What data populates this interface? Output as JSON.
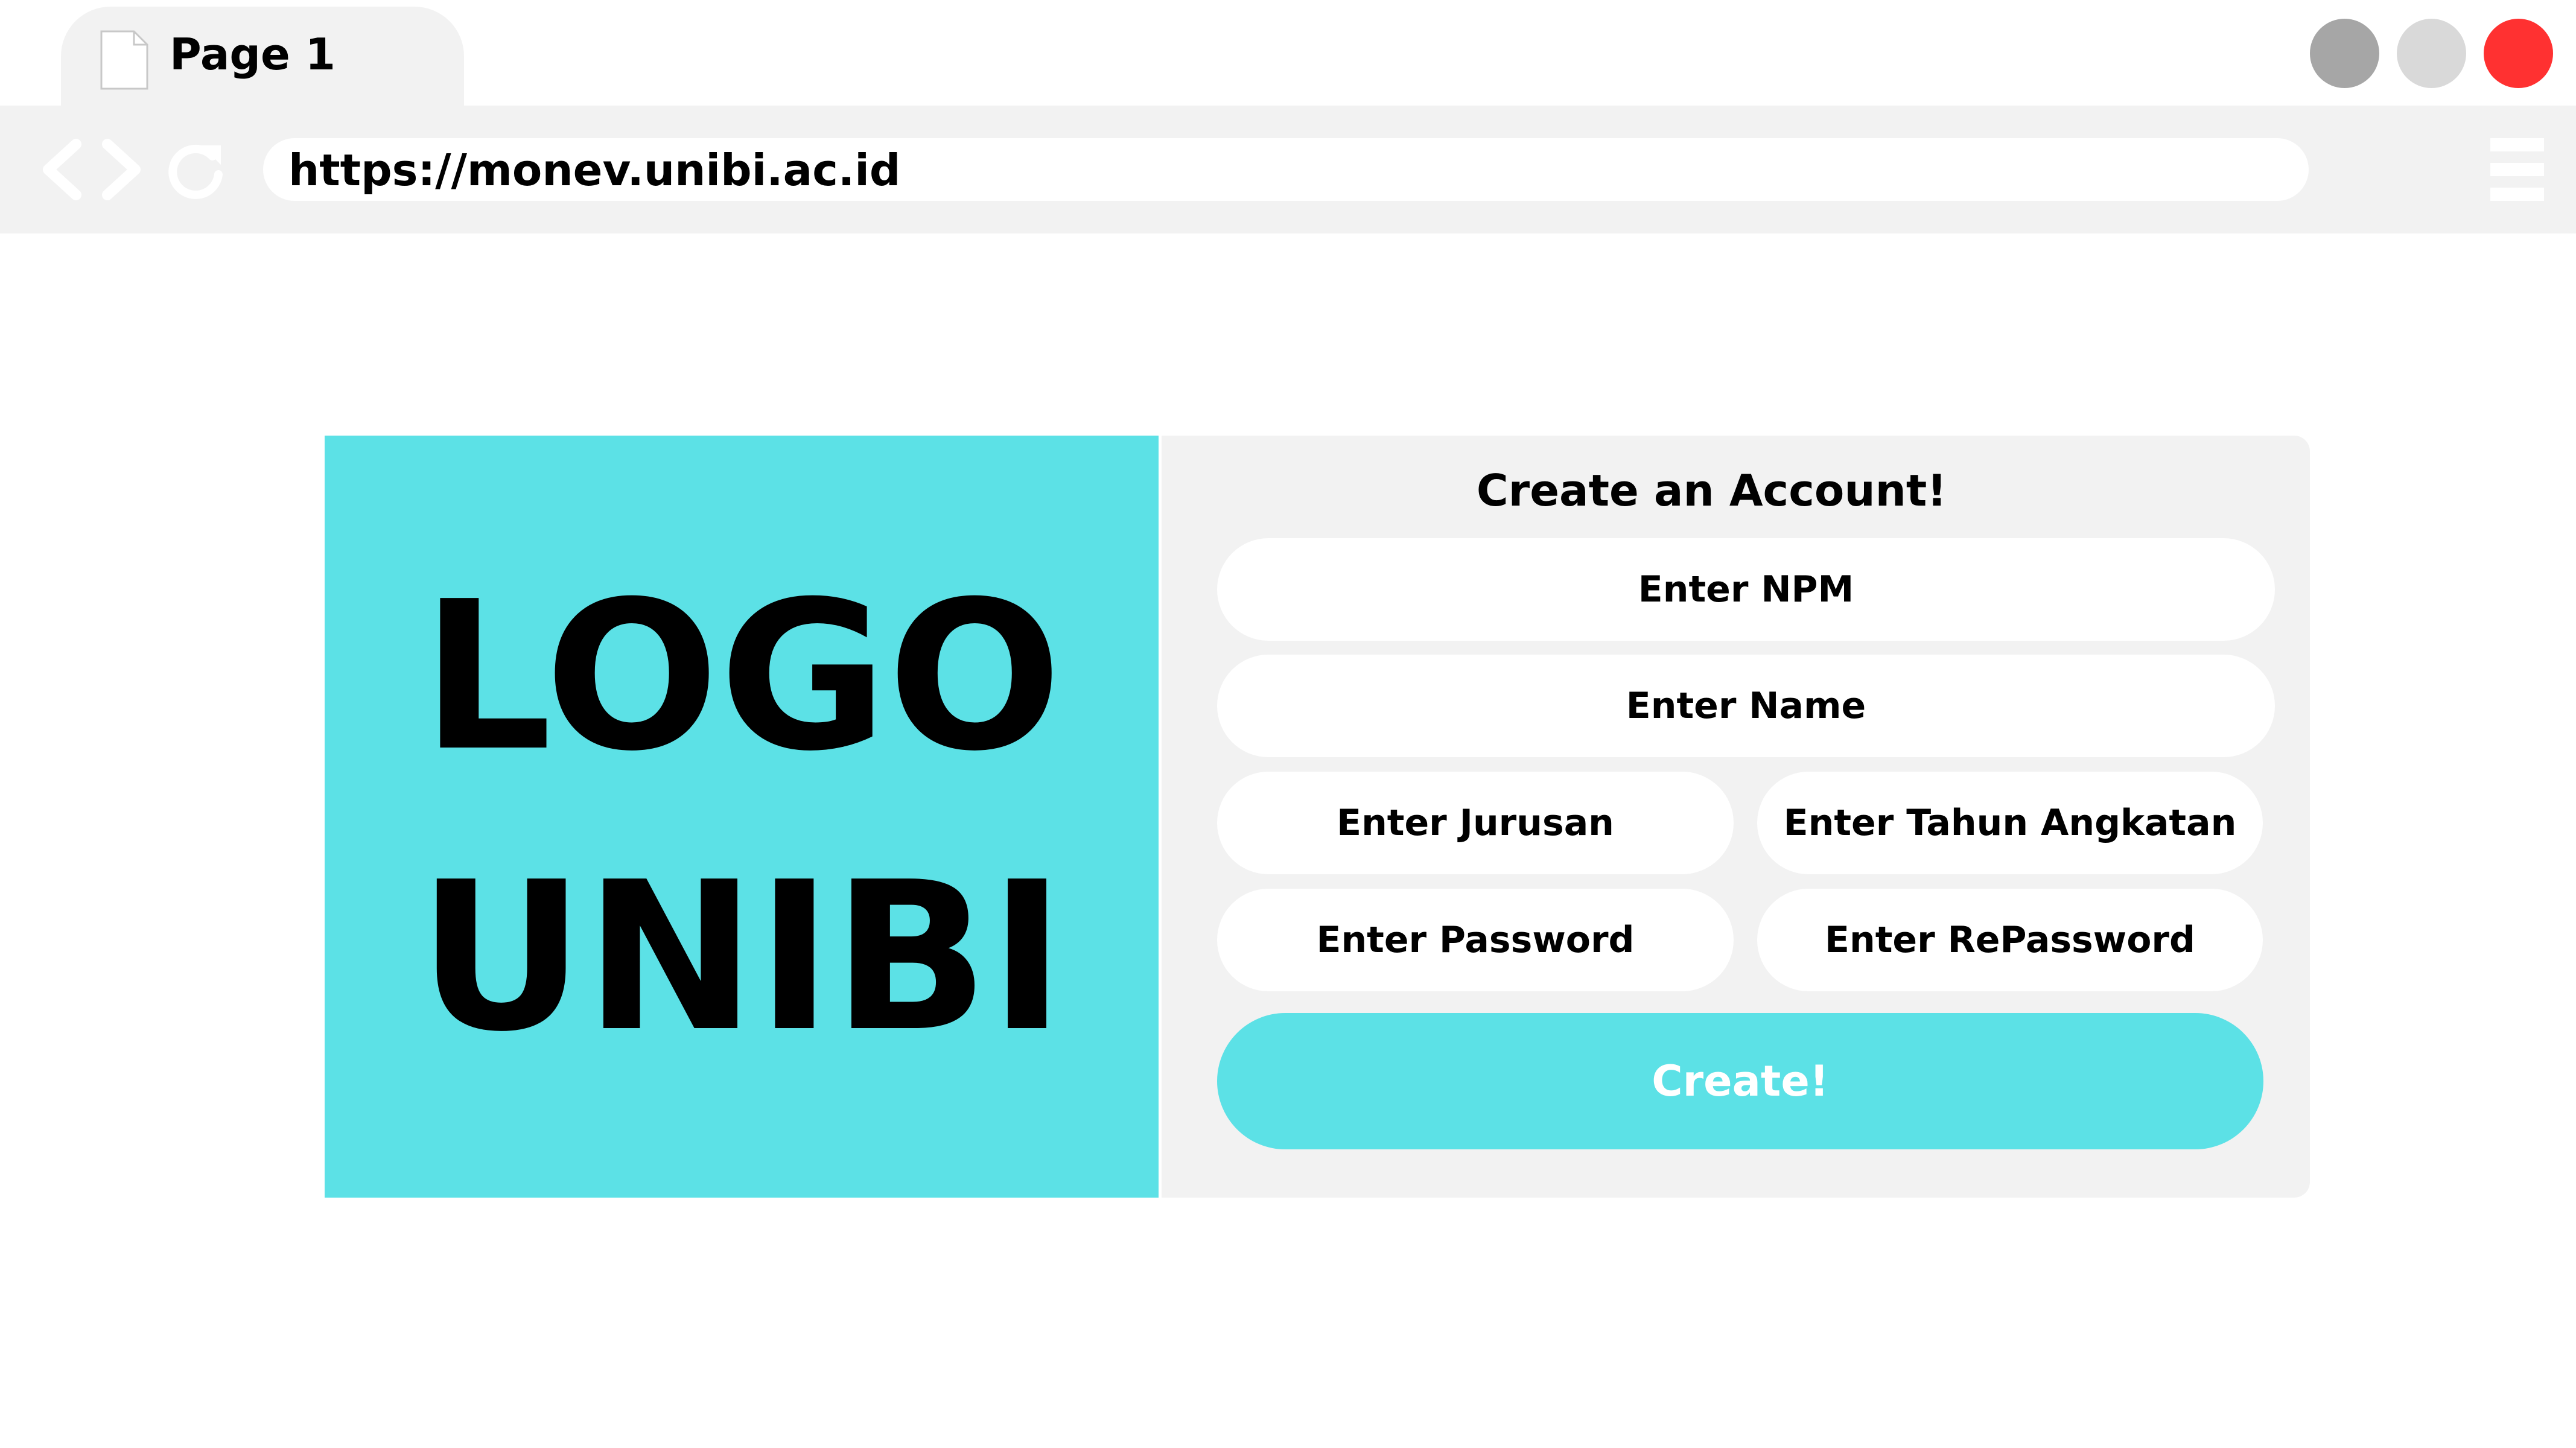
{
  "tab": {
    "title": "Page 1",
    "icon": "document-icon"
  },
  "window_controls": {
    "minimize_color": "#a6a6a6",
    "maximize_color": "#d9d9d9",
    "close_color": "#ff3131"
  },
  "navigation": {
    "url": "https://monev.unibi.ac.id",
    "back_icon": "chevron-left-icon",
    "forward_icon": "chevron-right-icon",
    "reload_icon": "reload-icon",
    "menu_icon": "hamburger-menu-icon"
  },
  "logo": {
    "line1": "LOGO",
    "line2": "UNIBI",
    "background_color": "#5ce1e6"
  },
  "form": {
    "title": "Create an Account!",
    "fields": {
      "npm": "Enter NPM",
      "name": "Enter Name",
      "jurusan": "Enter Jurusan",
      "tahun_angkatan": "Enter Tahun Angkatan",
      "password": "Enter Password",
      "repassword": "Enter RePassword"
    },
    "submit_label": "Create!",
    "accent_color": "#5ce1e6"
  }
}
